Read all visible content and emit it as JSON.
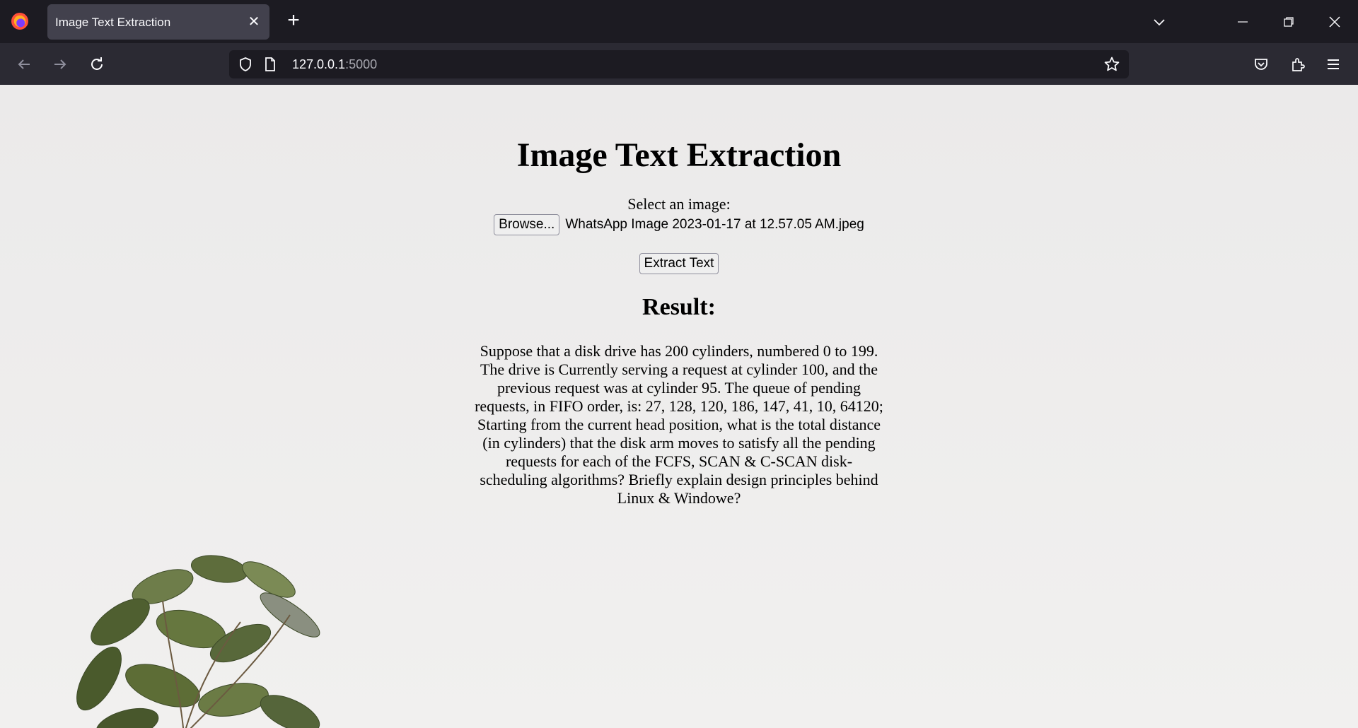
{
  "browser": {
    "tab_title": "Image Text Extraction",
    "url_host": "127.0.0.1",
    "url_port": ":5000"
  },
  "page": {
    "heading": "Image Text Extraction",
    "select_label": "Select an image:",
    "browse_label": "Browse...",
    "selected_file": "WhatsApp Image 2023-01-17 at 12.57.05 AM.jpeg",
    "extract_button": "Extract Text",
    "result_heading": "Result:",
    "result_text": "Suppose that a disk drive has 200 cylinders, numbered 0 to 199. The drive is Currently serving a request at cylinder 100, and the previous request was at cylinder 95. The queue of pending requests, in FIFO order, is: 27, 128, 120, 186, 147, 41, 10, 64120; Starting from the current head position, what is the total distance (in cylinders) that the disk arm moves to satisfy all the pending requests for each of the FCFS, SCAN & C-SCAN disk-scheduling algorithms? Briefly explain design principles behind Linux & Windowe?"
  },
  "icons": {
    "logo": "firefox-logo-icon",
    "close_tab": "close-icon",
    "new_tab": "plus-icon",
    "tab_list": "chevron-down-icon",
    "back": "arrow-left-icon",
    "forward": "arrow-right-icon",
    "reload": "reload-icon",
    "tracking": "shield-icon",
    "page": "page-icon",
    "bookmark": "star-icon",
    "pocket": "pocket-icon",
    "extensions": "puzzle-icon",
    "menu": "hamburger-icon"
  },
  "colors": {
    "tabbar_bg": "#1c1b22",
    "navbar_bg": "#2b2a33",
    "active_tab_bg": "#42414d",
    "page_bg": "#eeeded"
  }
}
